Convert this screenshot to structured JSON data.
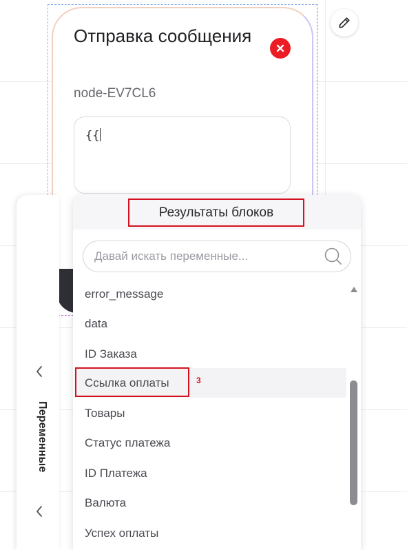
{
  "node": {
    "title": "Отправка сообщения",
    "id": "node-EV7CL6",
    "input_value": "{{"
  },
  "variables_tab": {
    "label": "Переменные"
  },
  "dropdown": {
    "title": "Результаты блоков",
    "search_placeholder": "Давай искать переменные...",
    "items": [
      "error_message",
      "data",
      "ID Заказа",
      "Ссылка оплаты",
      "Товары",
      "Статус платежа",
      "ID Платежа",
      "Валюта",
      "Успех оплаты"
    ],
    "highlighted_index": 3
  },
  "annotation": {
    "marker": "3"
  },
  "colors": {
    "accent_red": "#d4121f",
    "close_red": "#ec1c24",
    "highlight_bg": "#f3f3f5"
  },
  "icons": [
    "close-icon",
    "pencil-icon",
    "search-icon",
    "chevron-left-icon",
    "scroll-up-arrow-icon"
  ]
}
